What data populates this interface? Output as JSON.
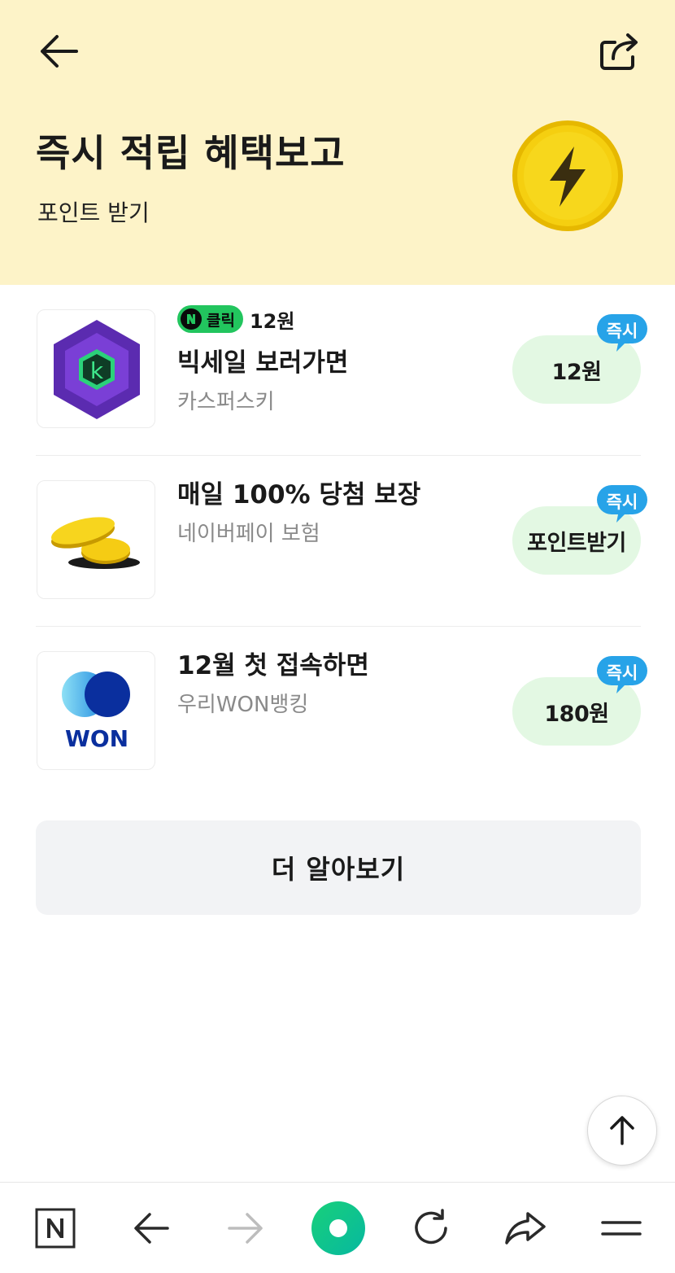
{
  "header": {
    "title": "즉시 적립 혜택보고",
    "subtitle": "포인트 받기",
    "back_icon": "arrow-left-icon",
    "share_icon": "share-icon",
    "hero_icon": "lightning-coin-icon"
  },
  "offers": [
    {
      "badge": "클릭",
      "badge_amount": "12원",
      "title": "빅세일 보러가면",
      "brand": "카스퍼스키",
      "reward": "12원",
      "instant": "즉시",
      "thumb_icon": "kaspersky-logo",
      "thumb_letter": "k"
    },
    {
      "title": "매일 100% 당첨 보장",
      "brand": "네이버페이 보험",
      "reward": "포인트받기",
      "instant": "즉시",
      "thumb_icon": "gold-coins-icon"
    },
    {
      "title": "12월 첫 접속하면",
      "brand": "우리WON뱅킹",
      "reward": "180원",
      "instant": "즉시",
      "thumb_icon": "woori-won-logo",
      "thumb_text": "WON"
    }
  ],
  "more_button": "더 알아보기",
  "scroll_top_icon": "arrow-up-icon",
  "browser_nav": {
    "items": [
      "naver-home-icon",
      "back-icon",
      "forward-icon",
      "green-dot-icon",
      "refresh-icon",
      "share-icon",
      "menu-icon"
    ]
  },
  "colors": {
    "header_bg": "#fdf3c8",
    "reward_bg": "#e3f8e3",
    "badge_blue": "#27a3e8",
    "naver_green": "#22c55e"
  }
}
